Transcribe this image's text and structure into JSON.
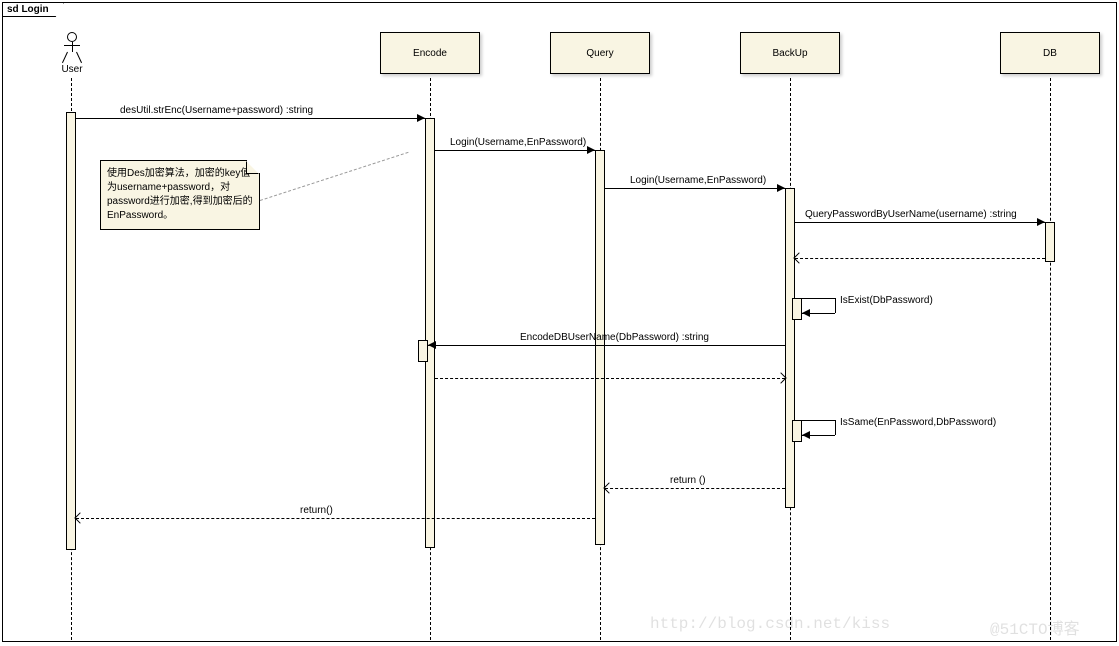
{
  "frame": {
    "label": "sd Login"
  },
  "actors": {
    "user": {
      "label": "User"
    }
  },
  "lifelines": {
    "encode": {
      "label": "Encode"
    },
    "query": {
      "label": "Query"
    },
    "backup": {
      "label": "BackUp"
    },
    "db": {
      "label": "DB"
    }
  },
  "messages": {
    "m1": "desUtil.strEnc(Username+password) :string",
    "m2": "Login(Username,EnPassword)",
    "m3": "Login(Username,EnPassword)",
    "m4": "QueryPasswordByUserName(username) :string",
    "m5": "IsExist(DbPassword)",
    "m6": "EncodeDBUserName(DbPassword) :string",
    "m7": "IsSame(EnPassword,DbPassword)",
    "m8": "return ()",
    "m9": "return()"
  },
  "note": {
    "text": "使用Des加密算法，加密的key值为username+password，对password进行加密,得到加密后的EnPassword。"
  },
  "watermarks": {
    "w1": "http://blog.csdn.net/kiss",
    "w2": "@51CTO博客"
  },
  "chart_data": {
    "type": "sequence_diagram",
    "title": "sd Login",
    "participants": [
      {
        "name": "User",
        "type": "actor"
      },
      {
        "name": "Encode",
        "type": "object"
      },
      {
        "name": "Query",
        "type": "object"
      },
      {
        "name": "BackUp",
        "type": "object"
      },
      {
        "name": "DB",
        "type": "object"
      }
    ],
    "messages": [
      {
        "from": "User",
        "to": "Encode",
        "label": "desUtil.strEnc(Username+password) :string",
        "type": "sync"
      },
      {
        "from": "Encode",
        "to": "Query",
        "label": "Login(Username,EnPassword)",
        "type": "sync"
      },
      {
        "from": "Query",
        "to": "BackUp",
        "label": "Login(Username,EnPassword)",
        "type": "sync"
      },
      {
        "from": "BackUp",
        "to": "DB",
        "label": "QueryPasswordByUserName(username) :string",
        "type": "sync"
      },
      {
        "from": "DB",
        "to": "BackUp",
        "label": "",
        "type": "return"
      },
      {
        "from": "BackUp",
        "to": "BackUp",
        "label": "IsExist(DbPassword)",
        "type": "self"
      },
      {
        "from": "BackUp",
        "to": "Encode",
        "label": "EncodeDBUserName(DbPassword) :string",
        "type": "sync"
      },
      {
        "from": "Encode",
        "to": "BackUp",
        "label": "",
        "type": "return"
      },
      {
        "from": "BackUp",
        "to": "BackUp",
        "label": "IsSame(EnPassword,DbPassword)",
        "type": "self"
      },
      {
        "from": "BackUp",
        "to": "Query",
        "label": "return ()",
        "type": "return"
      },
      {
        "from": "Query",
        "to": "User",
        "label": "return()",
        "type": "return"
      }
    ],
    "notes": [
      {
        "attached_to": "message_1",
        "text": "使用Des加密算法，加密的key值为username+password，对password进行加密,得到加密后的EnPassword。"
      }
    ]
  }
}
